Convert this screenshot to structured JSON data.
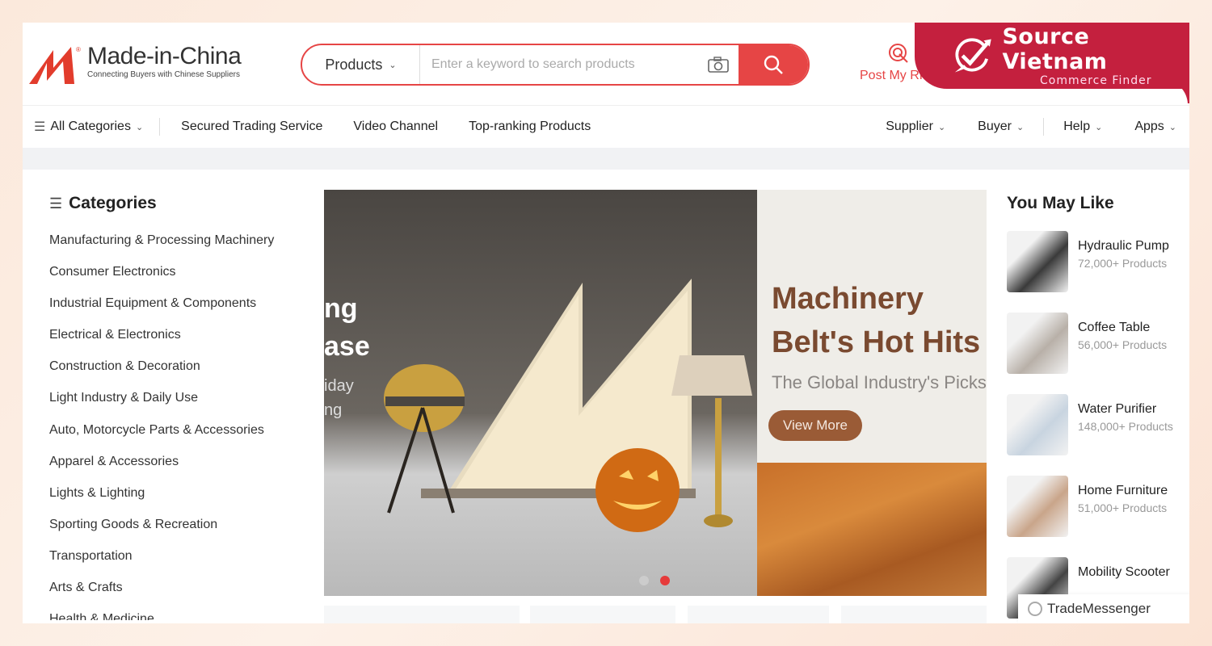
{
  "header": {
    "logo": {
      "name": "Made-in-China",
      "tagline": "Connecting Buyers with Chinese Suppliers"
    },
    "search": {
      "category": "Products",
      "placeholder": "Enter a keyword to search products"
    },
    "rfq_label": "Post My RFQ",
    "overlay_brand": {
      "title": "Source Vietnam",
      "subtitle": "Commerce Finder",
      "color": "#c4203e"
    }
  },
  "nav": {
    "all_categories": "All Categories",
    "links": [
      "Secured Trading Service",
      "Video Channel",
      "Top-ranking Products"
    ],
    "right": [
      "Supplier",
      "Buyer",
      "Help",
      "Apps"
    ]
  },
  "sidebar": {
    "title": "Categories",
    "items": [
      "Manufacturing & Processing Machinery",
      "Consumer Electronics",
      "Industrial Equipment & Components",
      "Electrical & Electronics",
      "Construction & Decoration",
      "Light Industry & Daily Use",
      "Auto, Motorcycle Parts & Accessories",
      "Apparel & Accessories",
      "Lights & Lighting",
      "Sporting Goods & Recreation",
      "Transportation",
      "Arts & Crafts",
      "Health & Medicine"
    ]
  },
  "banner": {
    "left_fragments": [
      "ng",
      "ase",
      "iday",
      "ng"
    ],
    "right_title_1": "Machinery",
    "right_title_2": "Belt's Hot Hits",
    "right_subtitle": "The Global Industry's Picks",
    "button": "View More",
    "active_slide": 2,
    "slide_count": 2
  },
  "you_may_like": {
    "title": "You May Like",
    "items": [
      {
        "name": "Hydraulic Pump",
        "count": "72,000+ Products"
      },
      {
        "name": "Coffee Table",
        "count": "56,000+ Products"
      },
      {
        "name": "Water Purifier",
        "count": "148,000+ Products"
      },
      {
        "name": "Home Furniture",
        "count": "51,000+ Products"
      },
      {
        "name": "Mobility Scooter",
        "count": ""
      }
    ]
  },
  "trade_messenger": "TradeMessenger",
  "colors": {
    "accent": "#e64545",
    "banner_brown": "#7a4a30"
  }
}
